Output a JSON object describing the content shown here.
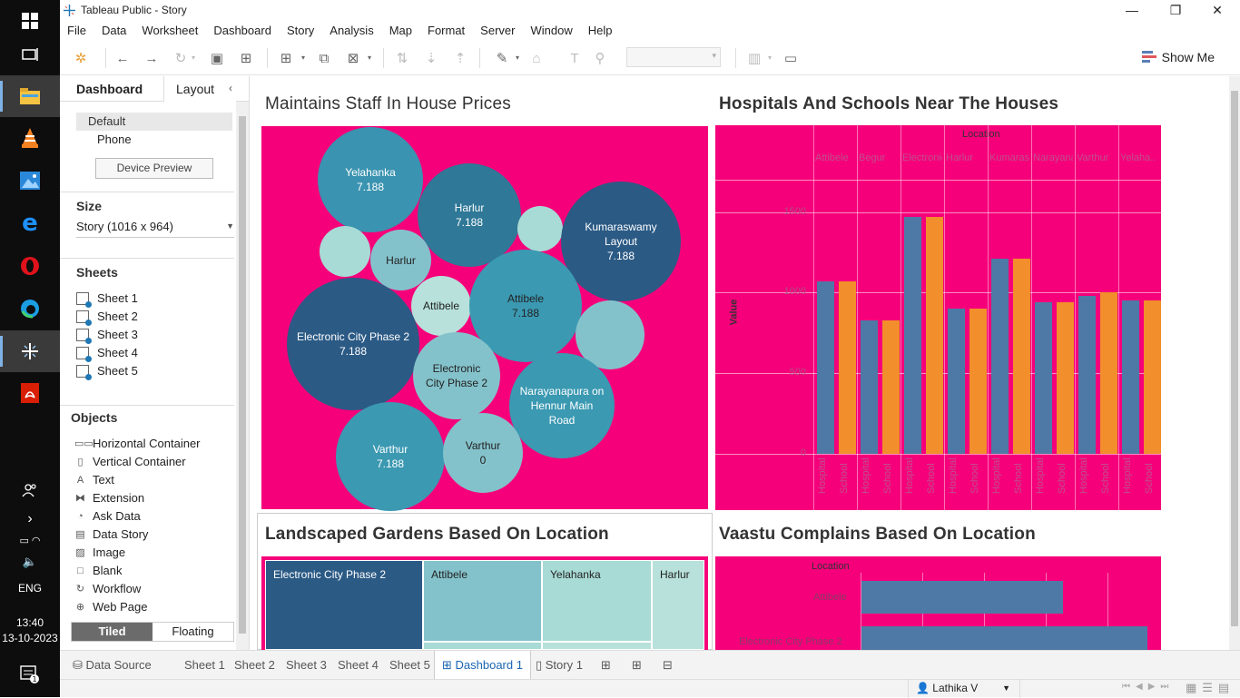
{
  "taskbar": {
    "time": "13:40",
    "date": "13-10-2023",
    "lang": "ENG",
    "notification_count": "1"
  },
  "window": {
    "title": "Tableau Public - Story"
  },
  "menu": [
    "File",
    "Data",
    "Worksheet",
    "Dashboard",
    "Story",
    "Analysis",
    "Map",
    "Format",
    "Server",
    "Window",
    "Help"
  ],
  "toolbar": {
    "show_me": "Show Me"
  },
  "left_panel": {
    "tab_dashboard": "Dashboard",
    "tab_layout": "Layout",
    "device_default": "Default",
    "device_phone": "Phone",
    "device_preview": "Device Preview",
    "size_title": "Size",
    "size_value": "Story (1016 x 964)",
    "sheets_title": "Sheets",
    "sheets": [
      "Sheet 1",
      "Sheet 2",
      "Sheet 3",
      "Sheet 4",
      "Sheet 5"
    ],
    "objects_title": "Objects",
    "objects": [
      "Horizontal Container",
      "Vertical Container",
      "Text",
      "Extension",
      "Ask Data",
      "Data Story",
      "Image",
      "Blank",
      "Workflow",
      "Web Page"
    ],
    "tiled": "Tiled",
    "floating": "Floating"
  },
  "dashboard": {
    "title_bubbles": "Maintains Staff  In House Prices",
    "title_bars": "Hospitals And Schools Near The Houses",
    "title_treemap": "Landscaped Gardens Based On Location",
    "title_vaastu": "Vaastu Complains Based On Location",
    "bubbles": [
      {
        "label": "Yelahanka",
        "value": "7.188"
      },
      {
        "label": "Harlur",
        "value": "7.188"
      },
      {
        "label": "Kumaraswamy Layout",
        "value": "7.188"
      },
      {
        "label": "Harlur",
        "value": ""
      },
      {
        "label": "Attibele",
        "value": ""
      },
      {
        "label": "Attibele",
        "value": "7.188"
      },
      {
        "label": "Electronic City Phase 2",
        "value": "7.188"
      },
      {
        "label": "Electronic City Phase 2",
        "value": ""
      },
      {
        "label": "Narayanapura on Hennur Main Road",
        "value": ""
      },
      {
        "label": "Varthur",
        "value": "7.188"
      },
      {
        "label": "Varthur",
        "value": "0"
      }
    ],
    "treemap_cells": [
      "Electronic City Phase 2",
      "Attibele",
      "Yelahanka",
      "Harlur"
    ],
    "vaastu_axis_title": "Location",
    "vaastu_rows": [
      "Attibele",
      "Electronic City Phase 2"
    ]
  },
  "chart_data": {
    "type": "bar",
    "title": "Hospitals And Schools Near The Houses",
    "column_header": "Location",
    "categories": [
      "Attibele",
      "Begur",
      "Electronic Cit..",
      "Harlur",
      "Kumaraswam..",
      "Narayanapur..",
      "Varthur",
      "Yelaha.."
    ],
    "sub_categories": [
      "Hospital",
      "School"
    ],
    "ylabel": "Value",
    "ylim": [
      0,
      1700
    ],
    "yticks": [
      "0",
      "500",
      "1000",
      "1500"
    ],
    "series": [
      {
        "name": "Hospital",
        "color": "#4e79a7",
        "values": [
          1070,
          830,
          1470,
          900,
          1210,
          940,
          980,
          950
        ]
      },
      {
        "name": "School",
        "color": "#f28e2b",
        "values": [
          1070,
          830,
          1470,
          900,
          1210,
          940,
          1000,
          950
        ]
      }
    ]
  },
  "bottom_tabs": {
    "data_source": "Data Source",
    "sheets": [
      "Sheet 1",
      "Sheet 2",
      "Sheet 3",
      "Sheet 4",
      "Sheet 5"
    ],
    "dashboard": "Dashboard 1",
    "story": "Story 1"
  },
  "status": {
    "user": "Lathika V"
  }
}
